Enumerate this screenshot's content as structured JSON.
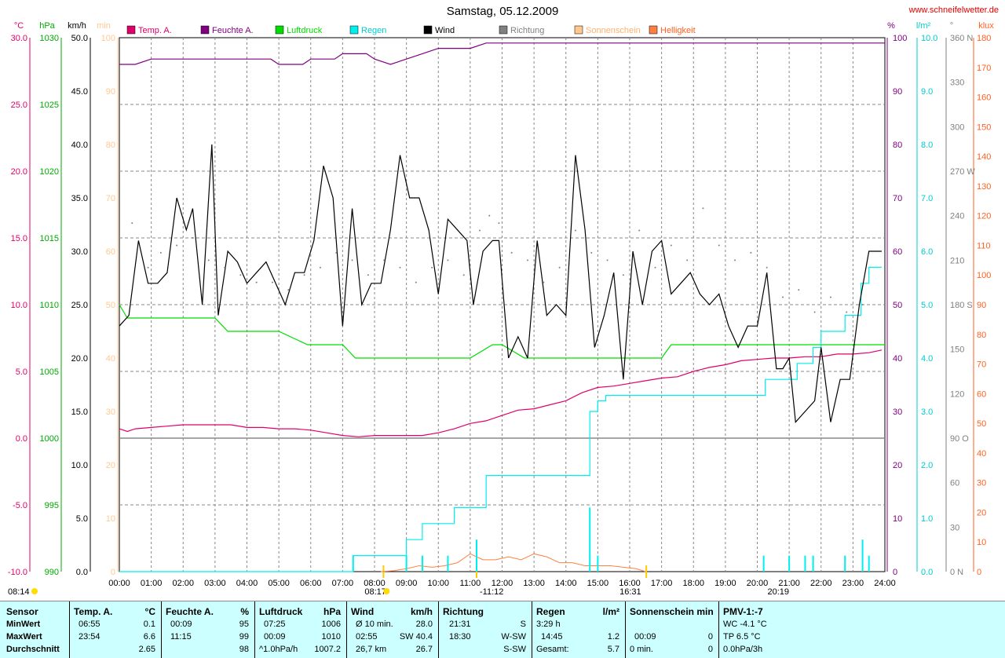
{
  "header": {
    "title": "Samstag, 05.12.2009",
    "site": "www.schneifelwetter.de"
  },
  "legend": [
    {
      "label": "Temp. A.",
      "color": "#e0006a"
    },
    {
      "label": "Feuchte A.",
      "color": "#800080"
    },
    {
      "label": "Luftdruck",
      "color": "#00dd00"
    },
    {
      "label": "Regen",
      "color": "#00eeee"
    },
    {
      "label": "Wind",
      "color": "#000000"
    },
    {
      "label": "Richtung",
      "color": "#808080"
    },
    {
      "label": "Sonnenschein",
      "color": "#ffc890"
    },
    {
      "label": "Helligkeit",
      "color": "#ff8040"
    }
  ],
  "axis_units": {
    "temp": "°C",
    "press": "hPa",
    "wind": "km/h",
    "sun": "min",
    "hum": "%",
    "rain": "l/m²",
    "dir": "°",
    "lux": "klux"
  },
  "axes": {
    "temp": [
      "30.0",
      "25.0",
      "20.0",
      "15.0",
      "10.0",
      "5.0",
      "0.0",
      "-5.0",
      "-10.0"
    ],
    "press": [
      "1030",
      "1025",
      "1020",
      "1015",
      "1010",
      "1005",
      "1000",
      "995",
      "990"
    ],
    "wind": [
      "50.0",
      "45.0",
      "40.0",
      "35.0",
      "30.0",
      "25.0",
      "20.0",
      "15.0",
      "10.0",
      "5.0",
      "0.0"
    ],
    "sun": [
      "100",
      "90",
      "80",
      "70",
      "60",
      "50",
      "40",
      "30",
      "20",
      "10",
      "0"
    ],
    "hum": [
      "100",
      "90",
      "80",
      "70",
      "60",
      "50",
      "40",
      "30",
      "20",
      "10",
      "0"
    ],
    "rain": [
      "10.0",
      "9.0",
      "8.0",
      "7.0",
      "6.0",
      "5.0",
      "4.0",
      "3.0",
      "2.0",
      "1.0",
      "0.0"
    ],
    "dir": [
      "360 N",
      "330",
      "300",
      "270 W",
      "240",
      "210",
      "180 S",
      "150",
      "120",
      "90 O",
      "60",
      "30",
      "0 N"
    ],
    "lux": [
      "180",
      "170",
      "160",
      "150",
      "140",
      "130",
      "120",
      "110",
      "100",
      "90",
      "80",
      "70",
      "60",
      "50",
      "40",
      "30",
      "20",
      "10",
      "0"
    ],
    "time": [
      "00:00",
      "01:00",
      "02:00",
      "03:00",
      "04:00",
      "05:00",
      "06:00",
      "07:00",
      "08:00",
      "09:00",
      "10:00",
      "11:00",
      "12:00",
      "13:00",
      "14:00",
      "15:00",
      "16:00",
      "17:00",
      "18:00",
      "19:00",
      "20:00",
      "21:00",
      "22:00",
      "23:00",
      "24:00"
    ]
  },
  "markers": {
    "sunrise_prev": "08:14",
    "sunrise": "08:17",
    "noon": "-11:12",
    "sunset": "16:31",
    "moon": "20:19"
  },
  "chart_data": {
    "type": "line",
    "title": "Samstag, 05.12.2009",
    "x_unit": "hours",
    "xlim": [
      0,
      24
    ],
    "series": [
      {
        "name": "Temp. A.",
        "unit": "°C",
        "axis": "temp",
        "ylim": [
          -10,
          30
        ],
        "color": "#e0006a",
        "x": [
          0,
          0.25,
          0.5,
          1,
          1.5,
          2,
          2.5,
          3,
          3.5,
          4,
          4.5,
          5,
          5.5,
          6,
          6.5,
          7,
          7.5,
          8,
          8.5,
          9,
          9.5,
          10,
          10.5,
          11,
          11.5,
          12,
          12.5,
          13,
          13.5,
          14,
          14.5,
          15,
          15.5,
          16,
          16.5,
          17,
          17.5,
          18,
          18.5,
          19,
          19.5,
          20,
          20.5,
          21,
          21.5,
          22,
          22.5,
          23,
          23.5,
          23.9
        ],
        "values": [
          0.7,
          0.5,
          0.7,
          0.8,
          0.9,
          1.0,
          1.0,
          1.0,
          1.0,
          0.8,
          0.8,
          0.7,
          0.7,
          0.6,
          0.4,
          0.2,
          0.1,
          0.2,
          0.2,
          0.2,
          0.2,
          0.4,
          0.7,
          1.1,
          1.3,
          1.7,
          2.1,
          2.2,
          2.5,
          2.8,
          3.4,
          3.8,
          3.9,
          4.1,
          4.3,
          4.5,
          4.6,
          5.0,
          5.3,
          5.5,
          5.8,
          5.9,
          6.0,
          6.0,
          6.1,
          6.1,
          6.3,
          6.3,
          6.4,
          6.6
        ]
      },
      {
        "name": "Feuchte A.",
        "unit": "%",
        "axis": "hum",
        "ylim": [
          0,
          100
        ],
        "color": "#800080",
        "x": [
          0,
          0.5,
          1,
          2,
          3,
          4,
          4.75,
          5,
          5.75,
          6,
          6.75,
          7,
          7.75,
          8,
          8.5,
          9,
          9.5,
          10,
          11,
          11.5,
          12,
          13,
          14,
          15,
          16,
          17,
          18,
          19,
          20,
          21,
          22,
          23,
          24
        ],
        "values": [
          95,
          95,
          96,
          96,
          96,
          96,
          96,
          95,
          95,
          96,
          96,
          97,
          97,
          96,
          95,
          96,
          97,
          98,
          98,
          99,
          99,
          99,
          99,
          99,
          99,
          99,
          99,
          99,
          99,
          99,
          99,
          99,
          99
        ]
      },
      {
        "name": "Luftdruck",
        "unit": "hPa",
        "axis": "press",
        "ylim": [
          990,
          1030
        ],
        "color": "#00dd00",
        "x": [
          0,
          0.25,
          1,
          2,
          3,
          3.4,
          4,
          5,
          5.9,
          6,
          7,
          7.4,
          8,
          9,
          10,
          11,
          11.7,
          12,
          12.7,
          13,
          14,
          15,
          16,
          17,
          17.3,
          18,
          19,
          20,
          21,
          22,
          23,
          24
        ],
        "values": [
          1010,
          1009,
          1009,
          1009,
          1009,
          1008,
          1008,
          1008,
          1007,
          1007,
          1007,
          1006,
          1006,
          1006,
          1006,
          1006,
          1007,
          1007,
          1006,
          1006,
          1006,
          1006,
          1006,
          1006,
          1007,
          1007,
          1007,
          1007,
          1007,
          1007,
          1007,
          1007
        ]
      },
      {
        "name": "Regen",
        "unit": "l/m²",
        "axis": "rain",
        "ylim": [
          0,
          10
        ],
        "color": "#00eeee",
        "x": [
          0,
          7.25,
          7.33,
          8.5,
          9,
          9.5,
          10,
          10.5,
          11,
          11.5,
          12,
          13,
          14,
          14.5,
          14.75,
          15,
          15.25,
          16,
          17,
          18,
          19,
          20,
          20.25,
          21,
          21.25,
          21.75,
          22,
          22.5,
          22.75,
          23,
          23.25,
          23.5,
          23.9
        ],
        "values": [
          0,
          0,
          0.3,
          0.3,
          0.6,
          0.9,
          0.9,
          1.2,
          1.2,
          1.8,
          1.8,
          1.8,
          1.8,
          1.8,
          3.0,
          3.2,
          3.3,
          3.3,
          3.3,
          3.3,
          3.3,
          3.3,
          3.6,
          3.6,
          3.9,
          4.2,
          4.5,
          4.5,
          4.8,
          4.8,
          5.4,
          5.7,
          5.7
        ]
      },
      {
        "name": "Wind",
        "unit": "km/h",
        "axis": "wind",
        "ylim": [
          0,
          50
        ],
        "color": "#000000",
        "x": [
          0,
          0.3,
          0.6,
          0.9,
          1.2,
          1.5,
          1.8,
          2.1,
          2.3,
          2.6,
          2.9,
          3.1,
          3.4,
          3.7,
          4,
          4.3,
          4.6,
          4.9,
          5.2,
          5.5,
          5.8,
          6.1,
          6.4,
          6.7,
          7,
          7.3,
          7.6,
          7.9,
          8.2,
          8.5,
          8.8,
          9.1,
          9.4,
          9.7,
          10,
          10.3,
          10.6,
          10.9,
          11.1,
          11.4,
          11.7,
          11.9,
          12.2,
          12.5,
          12.8,
          13.1,
          13.4,
          13.7,
          14,
          14.3,
          14.6,
          14.9,
          15.2,
          15.5,
          15.8,
          16.1,
          16.4,
          16.7,
          17,
          17.3,
          17.6,
          17.9,
          18.2,
          18.5,
          18.8,
          19.1,
          19.4,
          19.7,
          20,
          20.3,
          20.6,
          20.8,
          21,
          21.2,
          21.5,
          21.8,
          22,
          22.3,
          22.6,
          22.9,
          23.2,
          23.5,
          23.9
        ],
        "values": [
          23,
          24,
          31,
          27,
          27,
          28,
          35,
          32,
          34,
          25,
          40,
          24,
          30,
          29,
          27,
          28,
          29,
          27,
          25,
          28,
          28,
          31,
          38,
          35,
          23,
          34,
          25,
          27,
          27,
          32,
          39,
          35,
          35,
          32,
          26,
          33,
          32,
          31,
          25,
          30,
          31,
          31,
          20,
          22,
          20,
          31,
          24,
          25,
          24,
          39,
          32,
          21,
          24,
          28,
          18,
          30,
          25,
          30,
          31,
          26,
          27,
          28,
          26,
          25,
          26,
          23,
          21,
          23,
          23,
          28,
          19,
          19,
          20,
          14,
          15,
          16,
          21,
          14,
          18,
          18,
          25,
          30,
          30
        ]
      },
      {
        "name": "Richtung",
        "unit": "°",
        "axis": "dir",
        "ylim": [
          0,
          360
        ],
        "color": "#808080",
        "x": [
          0.4,
          0.9,
          1.3,
          1.8,
          2.3,
          2.8,
          3.3,
          3.8,
          4.3,
          4.8,
          5.3,
          5.8,
          6.3,
          6.8,
          7.3,
          7.8,
          8.3,
          8.8,
          9.3,
          9.8,
          10.3,
          10.8,
          11.3,
          11.6,
          11.9,
          12.3,
          12.8,
          13.3,
          13.8,
          14.3,
          14.8,
          15.3,
          15.8,
          16.3,
          16.8,
          17.3,
          17.8,
          18.3,
          18.8,
          19.3,
          19.8,
          20.3,
          20.8,
          21.3,
          21.8,
          22.3,
          22.8,
          23.3
        ],
        "values": [
          235,
          205,
          215,
          220,
          225,
          210,
          205,
          200,
          195,
          195,
          190,
          200,
          205,
          215,
          210,
          200,
          210,
          205,
          195,
          205,
          210,
          200,
          230,
          240,
          235,
          215,
          210,
          195,
          205,
          230,
          215,
          210,
          200,
          230,
          205,
          220,
          210,
          245,
          220,
          210,
          215,
          205,
          185,
          190,
          175,
          185,
          175,
          180
        ]
      },
      {
        "name": "Sonnenschein",
        "unit": "min",
        "axis": "sun",
        "ylim": [
          0,
          100
        ],
        "color": "#ffc890",
        "x": [],
        "values": []
      },
      {
        "name": "Helligkeit",
        "unit": "klux",
        "axis": "lux",
        "ylim": [
          0,
          180
        ],
        "color": "#ff8040",
        "x": [
          8.2,
          8.6,
          9,
          9.4,
          9.8,
          10.2,
          10.6,
          11,
          11.4,
          11.8,
          12.2,
          12.6,
          13,
          13.4,
          13.8,
          14.2,
          14.6,
          15,
          15.4,
          15.8,
          16.2,
          16.5
        ],
        "values": [
          0,
          0.3,
          1,
          2,
          1.5,
          2,
          3,
          6,
          4,
          4,
          5,
          4,
          6,
          5,
          3,
          3,
          2,
          2,
          2,
          1.5,
          1,
          0
        ]
      }
    ],
    "rain_bars": {
      "x": [
        7.33,
        9.0,
        9.5,
        10.3,
        11.2,
        14.75,
        15.0,
        20.2,
        21.0,
        21.5,
        21.75,
        22.75,
        23.3,
        23.5
      ],
      "values": [
        0.3,
        0.3,
        0.3,
        0.3,
        0.6,
        1.2,
        0.3,
        0.3,
        0.3,
        0.3,
        0.3,
        0.3,
        0.6,
        0.3
      ]
    }
  },
  "summary": {
    "row_labels": [
      "Sensor",
      "MinWert",
      "MaxWert",
      "Durchschnitt"
    ],
    "temp": {
      "title": "Temp. A.",
      "unit": "°C",
      "min_time": "06:55",
      "min": "0.1",
      "max_time": "23:54",
      "max": "6.6",
      "avg": "2.65"
    },
    "hum": {
      "title": "Feuchte A.",
      "unit": "%",
      "min_time": "00:09",
      "min": "95",
      "max_time": "11:15",
      "max": "99",
      "avg": "98"
    },
    "press": {
      "title": "Luftdruck",
      "unit": "hPa",
      "min_time": "07:25",
      "min": "1006",
      "max_time": "00:09",
      "max": "1010",
      "trend": "^1.0hPa/h",
      "avg": "1007.2"
    },
    "wind": {
      "title": "Wind",
      "unit": "km/h",
      "min_label": "Ø 10 min.",
      "min": "28.0",
      "max_time": "02:55",
      "max": "SW 40.4",
      "dist": "26,7 km",
      "avg": "26.7"
    },
    "dir": {
      "title": "Richtung",
      "min_time": "21:31",
      "min": "S",
      "max_time": "18:30",
      "max": "W-SW",
      "avg": "S-SW"
    },
    "rain": {
      "title": "Regen",
      "unit": "l/m²",
      "r1_time": "3:29 h",
      "r2_time": "14:45",
      "r2": "1.2",
      "total_label": "Gesamt:",
      "total": "5.7"
    },
    "sun": {
      "title": "Sonnenschein min",
      "r2_time": "00:09",
      "r2": "0",
      "r3_label": "0 min.",
      "r3": "0"
    },
    "pmv": {
      "title": "PMV-1:-7",
      "r1": "WC -4.1 °C",
      "r2": "TP 6.5 °C",
      "r3": "0.0hPa/3h"
    }
  }
}
